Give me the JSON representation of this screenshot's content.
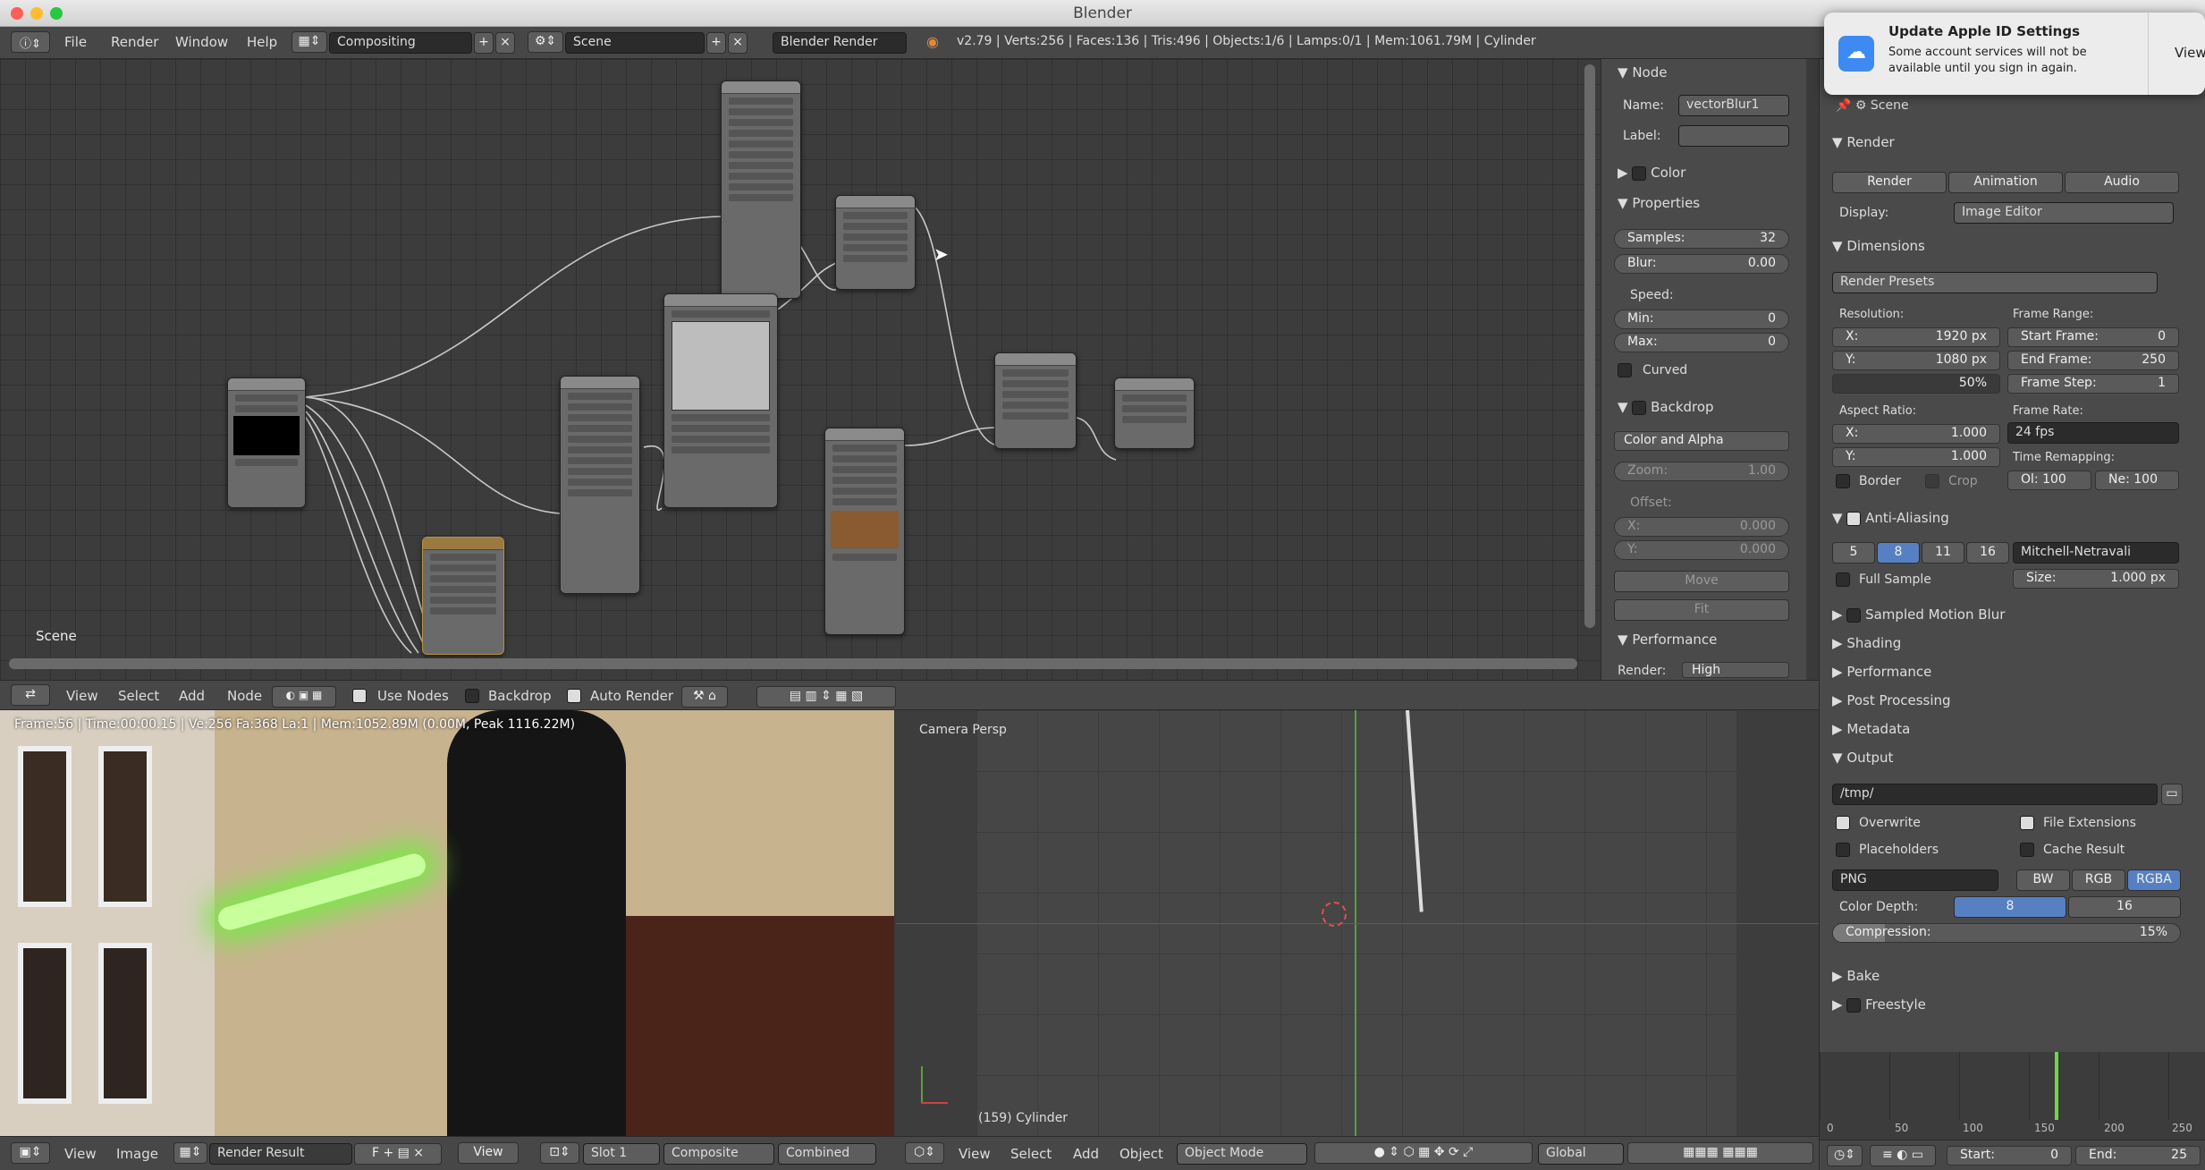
{
  "window": {
    "title": "Blender"
  },
  "menu": {
    "items": [
      "File",
      "Render",
      "Window",
      "Help"
    ],
    "screen_layout": "Compositing",
    "scene": "Scene",
    "engine": "Blender Render",
    "stats": "v2.79 | Verts:256 | Faces:136 | Tris:496 | Objects:1/6 | Lamps:0/1 | Mem:1061.79M | Cylinder"
  },
  "node_editor": {
    "scene_label": "Scene"
  },
  "node_panel": {
    "node_header": "Node",
    "name_label": "Name:",
    "name_value": "vectorBlur1",
    "label_label": "Label:",
    "color_label": "Color",
    "properties_label": "Properties",
    "samples": "Samples:",
    "samples_val": "32",
    "blur": "Blur:",
    "blur_val": "0.00",
    "speed": "Speed:",
    "min": "Min:",
    "min_val": "0",
    "max": "Max:",
    "max_val": "0",
    "curved": "Curved",
    "backdrop": "Backdrop",
    "color_alpha": "Color and Alpha",
    "zoom": "Zoom:",
    "zoom_val": "1.00",
    "offset": "Offset:",
    "ox": "X:",
    "ox_val": "0.000",
    "oy": "Y:",
    "oy_val": "0.000",
    "move": "Move",
    "fit": "Fit",
    "performance": "Performance",
    "render_label": "Render:",
    "render_val": "High"
  },
  "node_header2": {
    "view": "View",
    "select": "Select",
    "add": "Add",
    "node": "Node",
    "use_nodes": "Use Nodes",
    "backdrop": "Backdrop",
    "auto_render": "Auto Render"
  },
  "image_editor": {
    "stats": "Frame:56 | Time:00:00.15 | Ve:256 Fa:368 La:1 | Mem:1052.89M (0.00M, Peak 1116.22M)"
  },
  "viewport": {
    "label": "Camera Persp",
    "object": "(159) Cylinder"
  },
  "bottom_bar": {
    "view": "View",
    "image": "Image",
    "render_result": "Render Result",
    "f": "F",
    "view2": "View",
    "slot": "Slot 1",
    "composite": "Composite",
    "combined": "Combined",
    "view3": "View",
    "select": "Select",
    "add": "Add",
    "object": "Object",
    "mode": "Object Mode",
    "global": "Global"
  },
  "notification": {
    "title": "Update Apple ID Settings",
    "body": "Some account services will not be available until you sign in again.",
    "action": "View"
  },
  "properties": {
    "scene": "Scene",
    "render_header": "Render",
    "render_btn": "Render",
    "animation_btn": "Animation",
    "audio_btn": "Audio",
    "display_label": "Display:",
    "display_val": "Image Editor",
    "dimensions": "Dimensions",
    "render_presets": "Render Presets",
    "resolution": "Resolution:",
    "res_x": "X:",
    "res_x_val": "1920 px",
    "res_y": "Y:",
    "res_y_val": "1080 px",
    "res_pct": "50%",
    "frame_range": "Frame Range:",
    "start_frame": "Start Frame:",
    "start_val": "0",
    "end_frame": "End Frame:",
    "end_val": "250",
    "frame_step": "Frame Step:",
    "step_val": "1",
    "aspect": "Aspect Ratio:",
    "ax": "X:",
    "ax_val": "1.000",
    "ay": "Y:",
    "ay_val": "1.000",
    "frame_rate": "Frame Rate:",
    "fps": "24 fps",
    "border": "Border",
    "crop": "Crop",
    "time_remap": "Time Remapping:",
    "old": "Ol:",
    "old_val": "100",
    "new": "Ne:",
    "new_val": "100",
    "aa": "Anti-Aliasing",
    "aa_vals": [
      "5",
      "8",
      "11",
      "16"
    ],
    "filter": "Mitchell-Netravali",
    "full_sample": "Full Sample",
    "size_label": "Size:",
    "size_val": "1.000 px",
    "smb": "Sampled Motion Blur",
    "shading": "Shading",
    "performance": "Performance",
    "post": "Post Processing",
    "metadata": "Metadata",
    "output": "Output",
    "path": "/tmp/",
    "overwrite": "Overwrite",
    "file_ext": "File Extensions",
    "placeholders": "Placeholders",
    "cache": "Cache Result",
    "format": "PNG",
    "bw": "BW",
    "rgb": "RGB",
    "rgba": "RGBA",
    "color_depth": "Color Depth:",
    "cd8": "8",
    "cd16": "16",
    "compression": "Compression:",
    "comp_val": "15%",
    "comp_frac": 0.15,
    "bake": "Bake",
    "freestyle": "Freestyle"
  },
  "timeline": {
    "ticks": [
      "0",
      "50",
      "100",
      "150",
      "200",
      "250"
    ],
    "start": "Start:",
    "start_val": "0",
    "end": "End:",
    "end_val": "25"
  },
  "colors": {
    "accent": "#5680c2",
    "socket": "#d8c838",
    "panel": "#4a4a4a"
  }
}
